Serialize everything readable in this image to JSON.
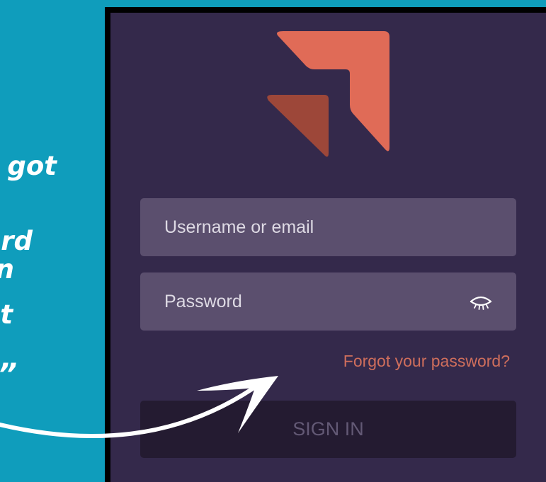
{
  "caption": {
    "lines": [
      "got",
      "rd",
      "n",
      "t",
      "”"
    ]
  },
  "login": {
    "username_placeholder": "Username or email",
    "password_placeholder": "Password",
    "forgot_link": "Forgot your password?",
    "signin_label": "SIGN IN",
    "password_toggle_icon": "eye-closed-icon"
  },
  "colors": {
    "page_background": "#0f9dbc",
    "screen_background": "#34294b",
    "field_background": "#5b4f6e",
    "accent": "#e06b57",
    "accent_dark": "#9d4739",
    "button_background": "#241b31"
  }
}
